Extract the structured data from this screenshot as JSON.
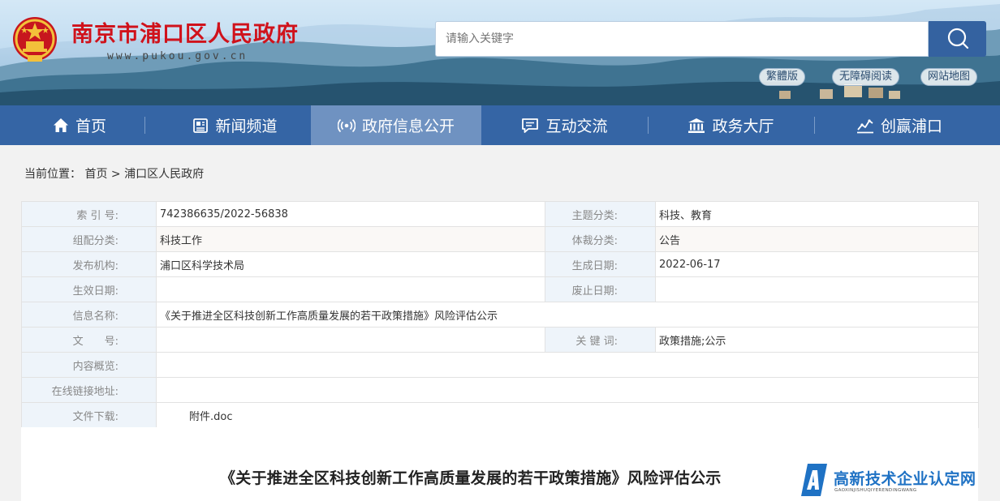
{
  "header": {
    "site_title": "南京市浦口区人民政府",
    "site_url": "www.pukou.gov.cn",
    "search_placeholder": "请输入关键字",
    "links": [
      "繁體版",
      "无障碍阅读",
      "网站地图"
    ]
  },
  "nav": [
    {
      "label": "首页",
      "icon": "home-icon",
      "active": false
    },
    {
      "label": "新闻频道",
      "icon": "newspaper-icon",
      "active": false
    },
    {
      "label": "政府信息公开",
      "icon": "broadcast-icon",
      "active": true
    },
    {
      "label": "互动交流",
      "icon": "chat-icon",
      "active": false
    },
    {
      "label": "政务大厅",
      "icon": "government-building-icon",
      "active": false
    },
    {
      "label": "创赢浦口",
      "icon": "chart-icon",
      "active": false
    }
  ],
  "breadcrumb": {
    "prefix": "当前位置：",
    "home": "首页",
    "separator": ">",
    "current": "浦口区人民政府"
  },
  "info": {
    "index_label": "索 引 号:",
    "index_value": "742386635/2022-56838",
    "topic_label": "主题分类:",
    "topic_value": "科技、教育",
    "group_label": "组配分类:",
    "group_value": "科技工作",
    "genre_label": "体裁分类:",
    "genre_value": "公告",
    "publisher_label": "发布机构:",
    "publisher_value": "浦口区科学技术局",
    "created_label": "生成日期:",
    "created_value": "2022-06-17",
    "effective_label": "生效日期:",
    "effective_value": "",
    "expire_label": "废止日期:",
    "expire_value": "",
    "name_label": "信息名称:",
    "name_value": "《关于推进全区科技创新工作高质量发展的若干政策措施》风险评估公示",
    "docno_label": "文　　号:",
    "docno_value": "",
    "keywords_label": "关 键 词:",
    "keywords_value": "政策措施;公示",
    "summary_label": "内容概览:",
    "summary_value": "",
    "online_label": "在线链接地址:",
    "online_value": "",
    "download_label": "文件下载:",
    "download_value": "附件.doc"
  },
  "content": {
    "title": "《关于推进全区科技创新工作高质量发展的若干政策措施》风险评估公示"
  },
  "watermark": {
    "title": "高新技术企业认定网",
    "subtitle": "GAOXINJISHUQIYERENDINGWANG"
  },
  "colors": {
    "nav_bg": "#3565a5",
    "nav_active": "#6f92c1",
    "title_red": "#d0121b",
    "label_bg": "#eef4fa",
    "watermark_blue": "#1f72c4"
  }
}
